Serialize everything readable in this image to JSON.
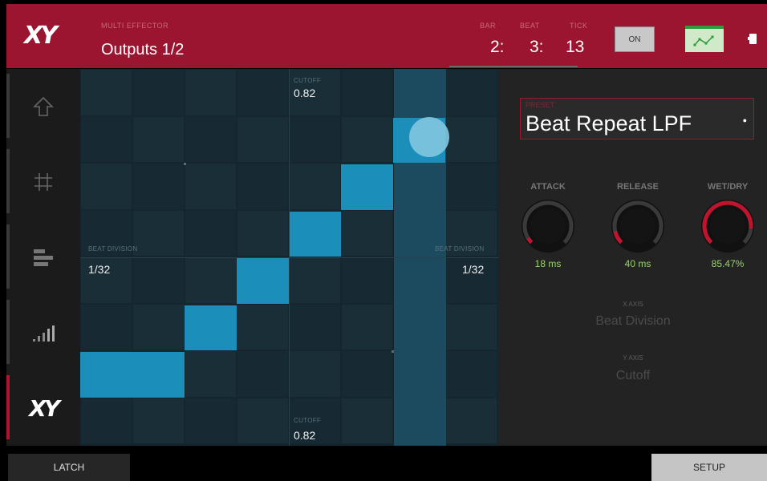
{
  "header": {
    "track_label": "MULTI EFFECTOR",
    "track_value": "Outputs 1/2",
    "bar_label": "BAR",
    "beat_label": "BEAT",
    "tick_label": "TICK",
    "bar": "2:",
    "beat": "3:",
    "tick": "13",
    "on_label": "ON"
  },
  "sidebar": {
    "items": [
      {
        "icon": "up-arrow-icon",
        "glyph": "⇧"
      },
      {
        "icon": "grid-icon",
        "glyph": "#"
      },
      {
        "icon": "bars-icon",
        "glyph": "≡"
      },
      {
        "icon": "level-meter-icon",
        "glyph": "▁▃▅"
      },
      {
        "icon": "xy-icon",
        "glyph": "XY",
        "active": true
      }
    ]
  },
  "pad": {
    "top_label": "CUTOFF",
    "top_value": "0.82",
    "bottom_label": "CUTOFF",
    "bottom_value": "0.82",
    "left_label": "BEAT DIVISION",
    "left_value": "1/32",
    "right_label": "BEAT DIVISION",
    "right_value": "1/32",
    "accent_color": "#1b8fba"
  },
  "right_panel": {
    "preset_label": "PRESET",
    "preset_value": "Beat Repeat LPF",
    "knobs": [
      {
        "label": "ATTACK",
        "value": "18 ms",
        "level": 0.05
      },
      {
        "label": "RELEASE",
        "value": "40 ms",
        "level": 0.12
      },
      {
        "label": "WET/DRY",
        "value": "85.47%",
        "level": 0.8547
      }
    ],
    "x_axis_label": "X AXIS",
    "x_axis_value": "Beat Division",
    "y_axis_label": "Y AXIS",
    "y_axis_value": "Cutoff",
    "knob_color": "#c0142e",
    "value_color": "#9bd36e"
  },
  "footer": {
    "latch": "LATCH",
    "setup": "SETUP"
  }
}
